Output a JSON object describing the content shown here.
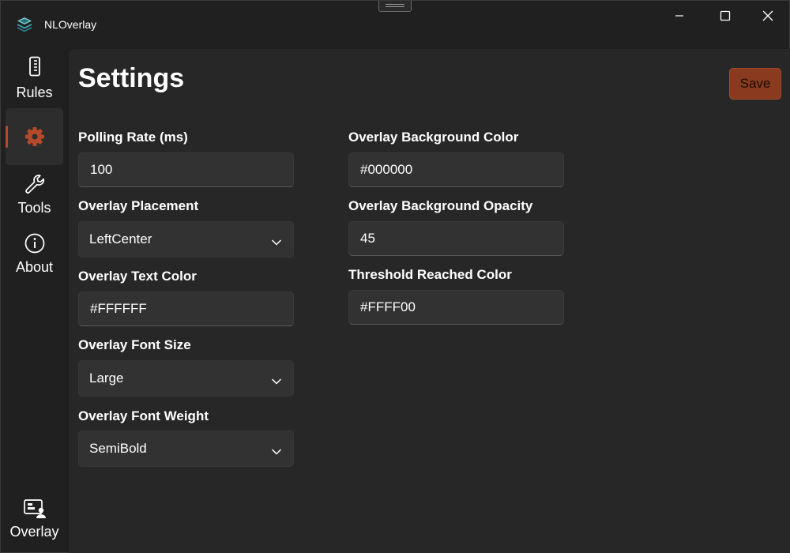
{
  "app": {
    "title": "NLOverlay"
  },
  "sidebar": {
    "items": [
      {
        "label": "Rules",
        "icon": "ruler-icon"
      },
      {
        "label": "",
        "icon": "gear-icon",
        "selected": true
      },
      {
        "label": "Tools",
        "icon": "wrench-icon"
      },
      {
        "label": "About",
        "icon": "info-icon"
      }
    ],
    "footer": {
      "label": "Overlay",
      "icon": "overlay-icon"
    }
  },
  "page": {
    "title": "Settings",
    "save_label": "Save"
  },
  "fields": {
    "polling_rate": {
      "label": "Polling Rate (ms)",
      "value": "100"
    },
    "overlay_placement": {
      "label": "Overlay Placement",
      "value": "LeftCenter"
    },
    "overlay_text_color": {
      "label": "Overlay Text Color",
      "value": "#FFFFFF"
    },
    "overlay_font_size": {
      "label": "Overlay Font Size",
      "value": "Large"
    },
    "overlay_font_weight": {
      "label": "Overlay Font Weight",
      "value": "SemiBold"
    },
    "overlay_bg_color": {
      "label": "Overlay Background Color",
      "value": "#000000"
    },
    "overlay_bg_opacity": {
      "label": "Overlay Background Opacity",
      "value": "45"
    },
    "threshold_color": {
      "label": "Threshold Reached Color",
      "value": "#FFFF00"
    }
  },
  "colors": {
    "accent": "#b54a2a",
    "save_button": "#8a3a1e",
    "window_bg": "#202020",
    "content_bg": "#272727",
    "field_bg": "#323232"
  }
}
